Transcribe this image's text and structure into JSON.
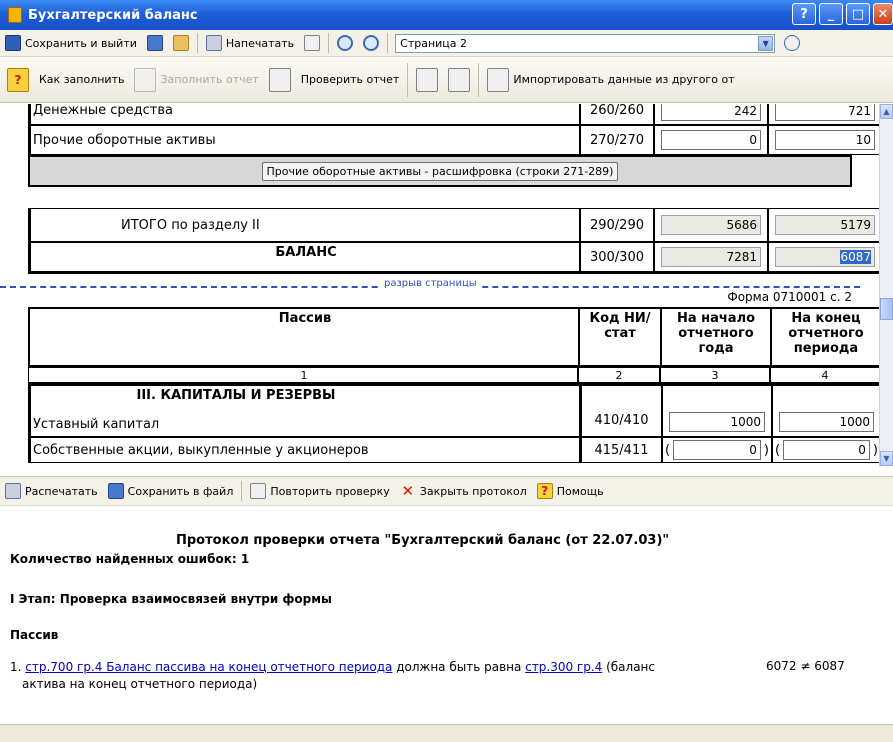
{
  "window": {
    "title": "Бухгалтерский баланс",
    "help": "?",
    "minimize": "_",
    "maximize": "□",
    "close": "✕"
  },
  "toolbar1": {
    "save_exit": "Сохранить и выйти",
    "print": "Напечатать",
    "page_value": "Страница 2"
  },
  "toolbar2": {
    "how_to_fill": "Как заполнить",
    "fill_report": "Заполнить отчет",
    "check_report": "Проверить отчет",
    "import_data": "Импортировать данные из другого от"
  },
  "form": {
    "rows_top": [
      {
        "name": "Денежные средства",
        "code": "260/260",
        "start": "242",
        "end": "721"
      },
      {
        "name": "Прочие оборотные активы",
        "code": "270/270",
        "start": "0",
        "end": "10"
      }
    ],
    "breakdown_button": "Прочие оборотные активы - расшифровка (строки 271-289)",
    "total_section2": {
      "name": "ИТОГО по разделу II",
      "code": "290/290",
      "start": "5686",
      "end": "5179"
    },
    "balance": {
      "name": "БАЛАНС",
      "code": "300/300",
      "start": "7281",
      "end": "6087"
    },
    "page_break": "разрыв страницы",
    "form_code": "Форма 0710001 с. 2",
    "header": {
      "col_passive": "Пассив",
      "col_code": "Код НИ/ стат",
      "col_start": "На начало отчетного года",
      "col_end": "На конец отчетного периода",
      "num1": "1",
      "num2": "2",
      "num3": "3",
      "num4": "4"
    },
    "section3_title": "III. КАПИТАЛЫ И РЕЗЕРВЫ",
    "rows_passive": [
      {
        "name": "Уставный капитал",
        "code": "410/410",
        "start": "1000",
        "end": "1000"
      },
      {
        "name": "Собственные акции, выкупленные у акционеров",
        "code": "415/411",
        "start": "0",
        "end": "0"
      }
    ]
  },
  "protocol_toolbar": {
    "print": "Распечатать",
    "save_file": "Сохранить в файл",
    "recheck": "Повторить проверку",
    "close_protocol": "Закрыть протокол",
    "help": "Помощь"
  },
  "protocol": {
    "title": "Протокол проверки отчета \"Бухгалтерский баланс (от 22.07.03)\"",
    "errors_count": "Количество найденных ошибок: 1",
    "stage1": "I Этап: Проверка взаимосвязей внутри формы",
    "section": "Пассив",
    "error_num": "1.",
    "error_link1": "стр.700 гр.4 Баланс пассива на конец отчетного периода",
    "error_mid": " должна быть равна ",
    "error_link2": "стр.300 гр.4",
    "error_tail": " (баланс",
    "error_line2": "актива на конец отчетного периода)",
    "error_values": "6072 ≠ 6087"
  }
}
